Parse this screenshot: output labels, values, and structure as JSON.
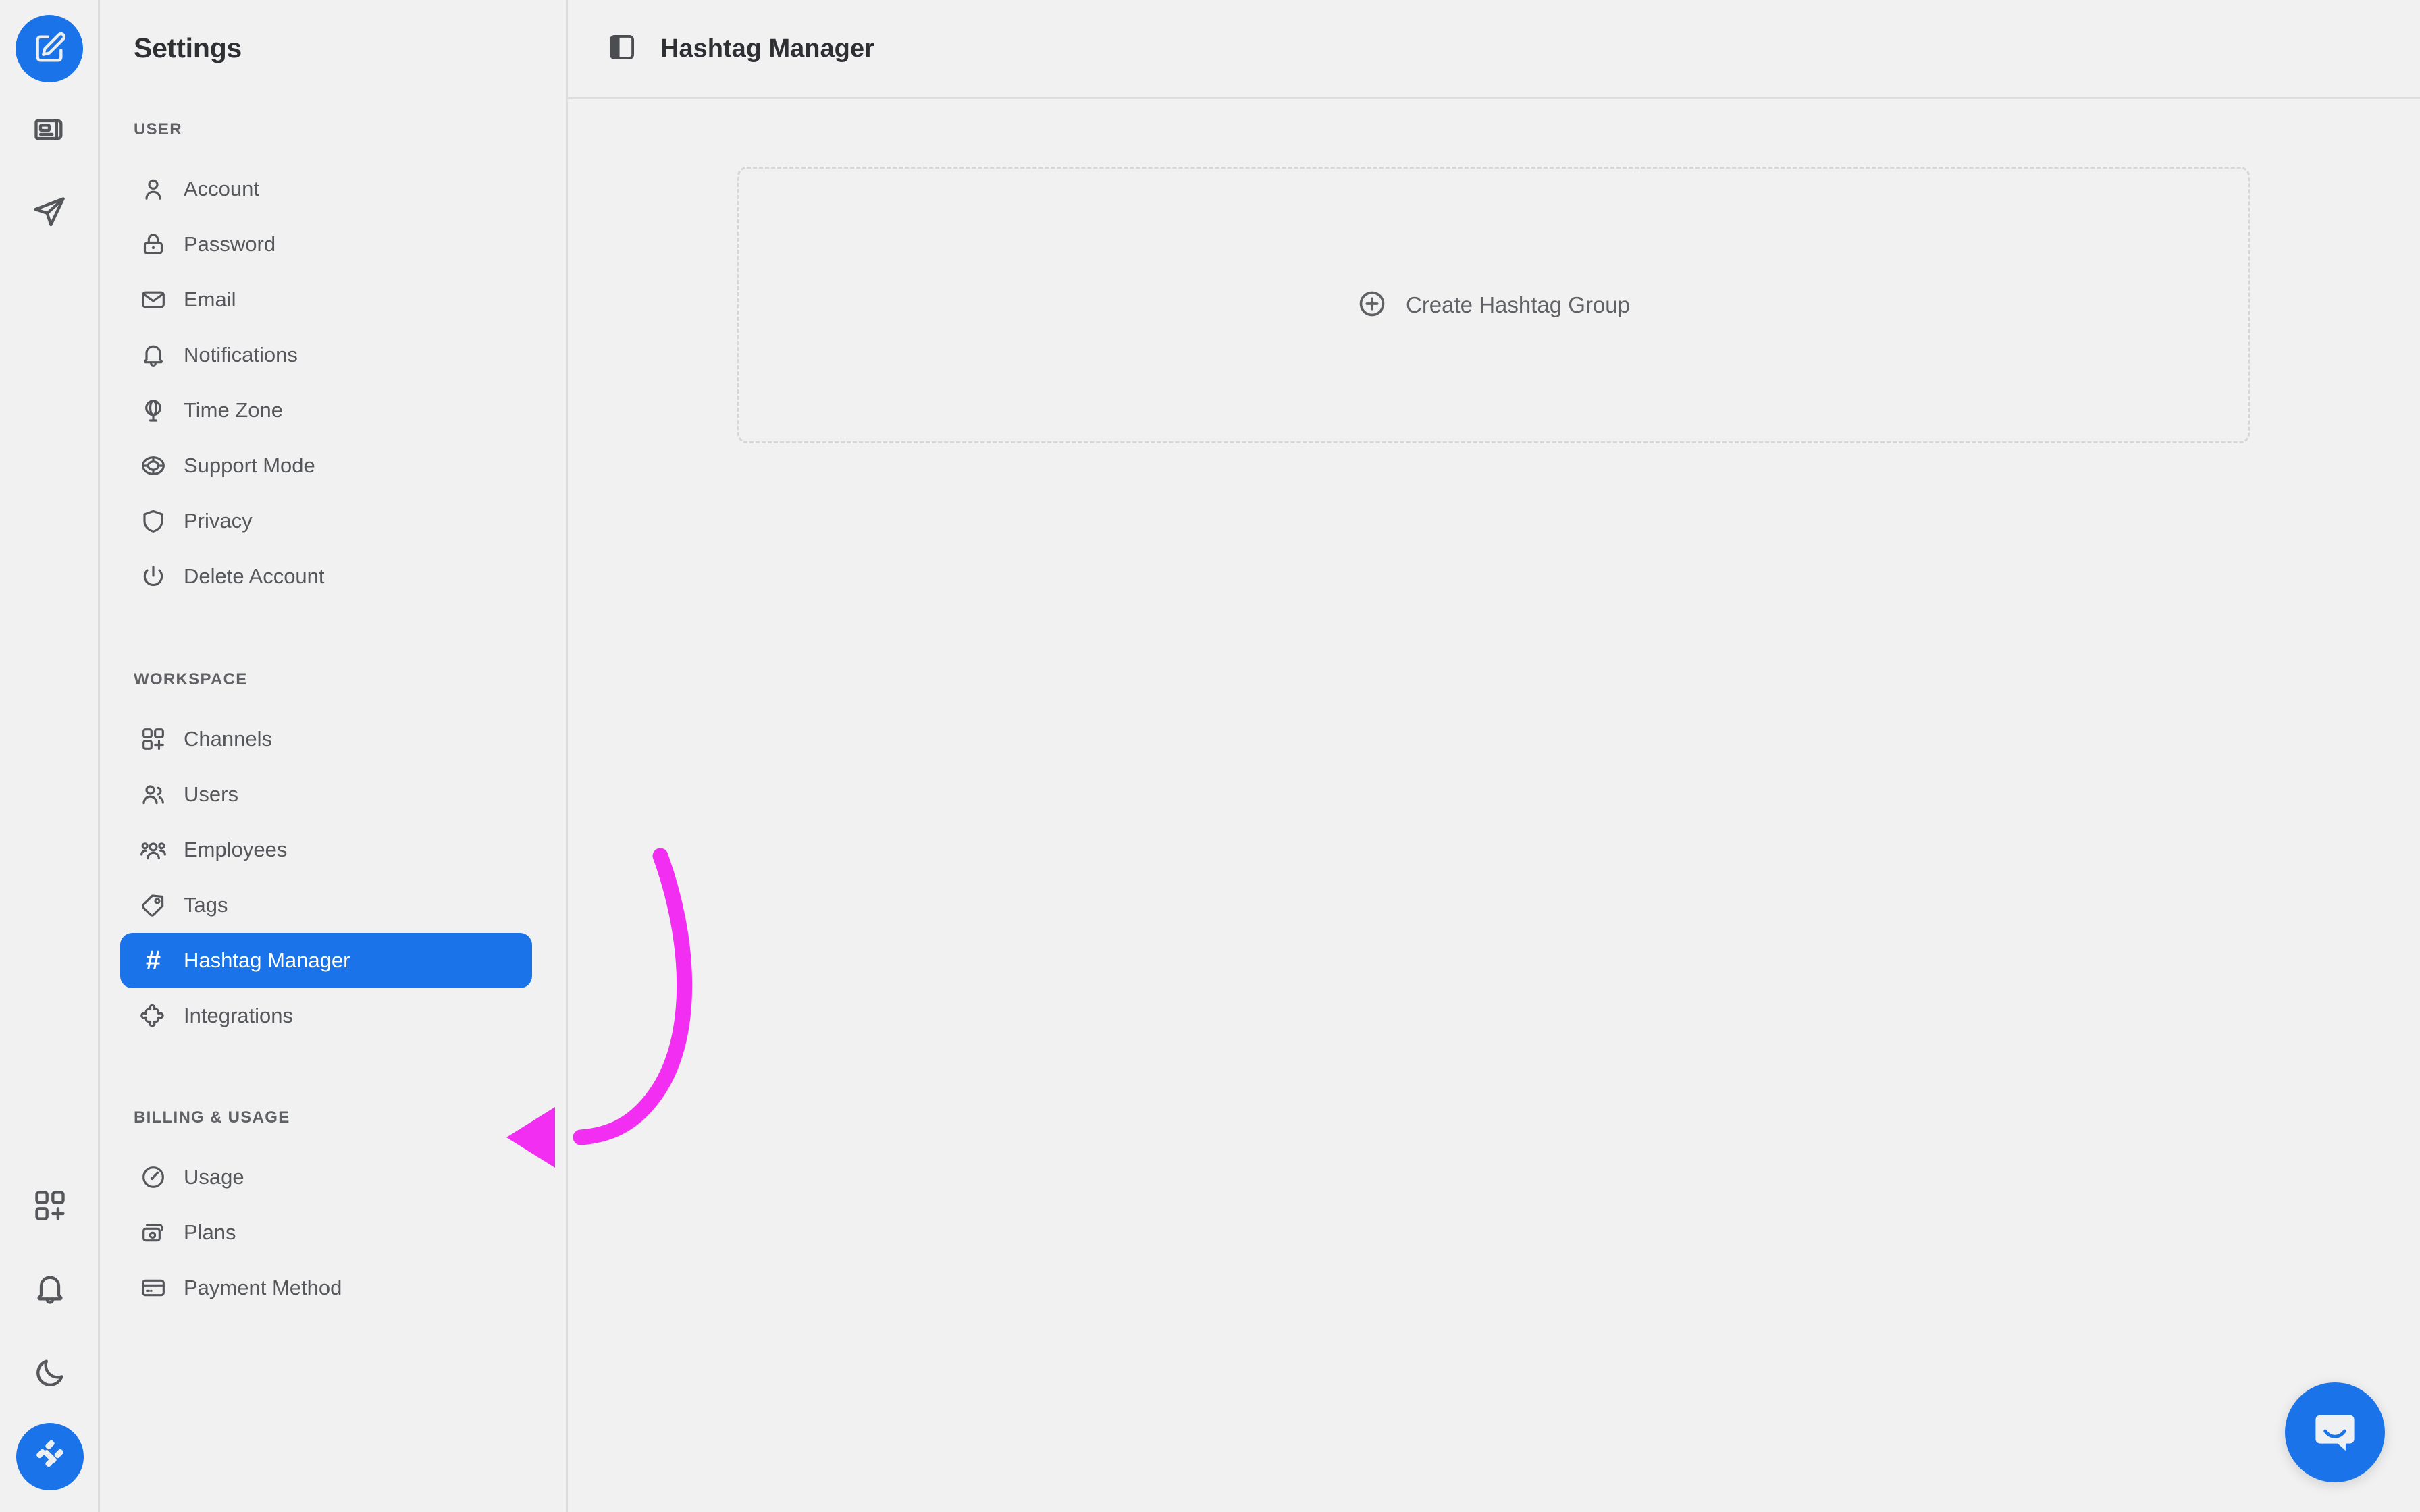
{
  "colors": {
    "accent": "#1a73e8",
    "annotation_arrow": "#f22ef2",
    "background": "#f1f1f2",
    "border": "#dddddf",
    "text_primary": "#2f3033",
    "text_secondary": "#55575b"
  },
  "rail": {
    "top_items": [
      {
        "name": "compose-icon",
        "label": "Compose"
      },
      {
        "name": "feed-icon",
        "label": "Feed"
      },
      {
        "name": "send-icon",
        "label": "Publish"
      }
    ],
    "bottom_items": [
      {
        "name": "apps-add-icon",
        "label": "Add App"
      },
      {
        "name": "bell-icon",
        "label": "Notifications"
      },
      {
        "name": "moon-icon",
        "label": "Dark Mode"
      },
      {
        "name": "workspace-avatar-icon",
        "label": "Workspace"
      }
    ]
  },
  "settings": {
    "title": "Settings",
    "sections": [
      {
        "label": "USER",
        "items": [
          {
            "label": "Account",
            "icon": "user-icon"
          },
          {
            "label": "Password",
            "icon": "lock-icon"
          },
          {
            "label": "Email",
            "icon": "mail-icon"
          },
          {
            "label": "Notifications",
            "icon": "bell-icon"
          },
          {
            "label": "Time Zone",
            "icon": "globe-icon"
          },
          {
            "label": "Support Mode",
            "icon": "lifebuoy-icon"
          },
          {
            "label": "Privacy",
            "icon": "shield-icon"
          },
          {
            "label": "Delete Account",
            "icon": "power-icon"
          }
        ]
      },
      {
        "label": "WORKSPACE",
        "items": [
          {
            "label": "Channels",
            "icon": "grid-add-icon"
          },
          {
            "label": "Users",
            "icon": "users-icon"
          },
          {
            "label": "Employees",
            "icon": "employees-icon"
          },
          {
            "label": "Tags",
            "icon": "tag-icon"
          },
          {
            "label": "Hashtag Manager",
            "icon": "hash-icon",
            "active": true
          },
          {
            "label": "Integrations",
            "icon": "puzzle-icon"
          }
        ]
      },
      {
        "label": "BILLING & USAGE",
        "items": [
          {
            "label": "Usage",
            "icon": "gauge-icon"
          },
          {
            "label": "Plans",
            "icon": "plans-icon"
          },
          {
            "label": "Payment Method",
            "icon": "credit-card-icon"
          }
        ]
      }
    ]
  },
  "main": {
    "header": {
      "panel_toggle_icon": "panel-toggle-icon",
      "title": "Hashtag Manager"
    },
    "create_group": {
      "icon": "plus-circle-icon",
      "label": "Create Hashtag Group"
    }
  },
  "support": {
    "launcher_icon": "intercom-messenger-icon"
  }
}
